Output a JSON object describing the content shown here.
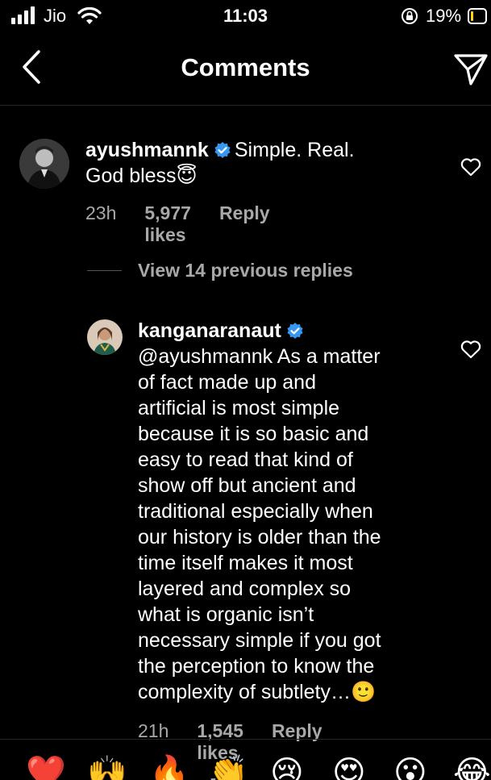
{
  "status_bar": {
    "carrier": "Jio",
    "time": "11:03",
    "battery_percent": "19%",
    "battery_level": 0.19,
    "battery_color": "#ffd60a"
  },
  "nav": {
    "title": "Comments",
    "back_icon": "chevron-left-icon",
    "send_icon": "paper-plane-icon"
  },
  "comments": [
    {
      "username": "ayushmannk",
      "verified": true,
      "text": "Simple. Real.",
      "text_line2": "God bless",
      "text_emoji": "😇",
      "age": "23h",
      "likes": "5,977 likes",
      "reply": "Reply"
    },
    {
      "username": "kanganaranaut",
      "verified": true,
      "lines": [
        "@ayushmannk As a matter",
        "of fact made up and",
        "artificial is most simple",
        "because it is so basic and",
        "easy to read that kind of",
        "show off but ancient and",
        "traditional especially when",
        "our history is older than the",
        "time itself makes it most",
        "layered and complex so",
        "what is organic isn’t",
        "necessary simple if you got",
        "the perception to know the",
        "complexity of subtlety…"
      ],
      "text_emoji": "🙂",
      "age": "21h",
      "likes": "1,545 likes",
      "reply": "Reply"
    }
  ],
  "view_replies": "View 14 previous replies",
  "colors": {
    "verified_blue": "#3897f0",
    "muted_text": "#a8a8a8"
  },
  "emoji_bar": [
    "❤️",
    "🙌",
    "🔥",
    "👏",
    "😢",
    "😍",
    "😮",
    "😂"
  ]
}
